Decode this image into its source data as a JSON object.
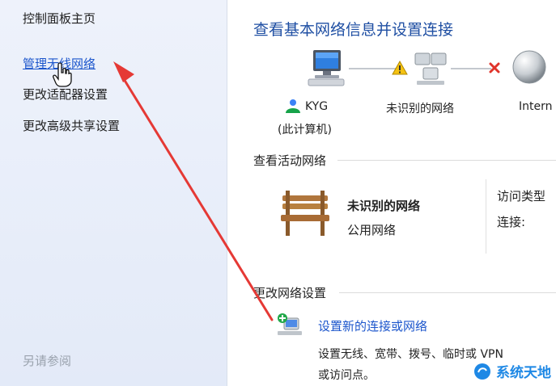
{
  "sidebar": {
    "items": [
      {
        "label": "控制面板主页"
      },
      {
        "label": "管理无线网络"
      },
      {
        "label": "更改适配器设置"
      },
      {
        "label": "更改高级共享设置"
      }
    ],
    "see_also": "另请参阅"
  },
  "main": {
    "title": "查看基本网络信息并设置连接",
    "map": {
      "computer_name": "KYG",
      "computer_sub": "(此计算机)",
      "network_name": "未识别的网络",
      "internet_label": "Intern"
    },
    "active": {
      "heading": "查看活动网络",
      "network_name": "未识别的网络",
      "network_type": "公用网络",
      "access_type_label": "访问类型",
      "connection_label": "连接:"
    },
    "change": {
      "heading": "更改网络设置",
      "setup_link": "设置新的连接或网络",
      "setup_desc_line1": "设置无线、宽带、拨号、临时或 VPN",
      "setup_desc_line2": "或访问点。"
    }
  },
  "watermark": {
    "text": "系统天地"
  },
  "colors": {
    "link": "#1c56cc",
    "title": "#1f4fa3",
    "arrow": "#e53935"
  }
}
